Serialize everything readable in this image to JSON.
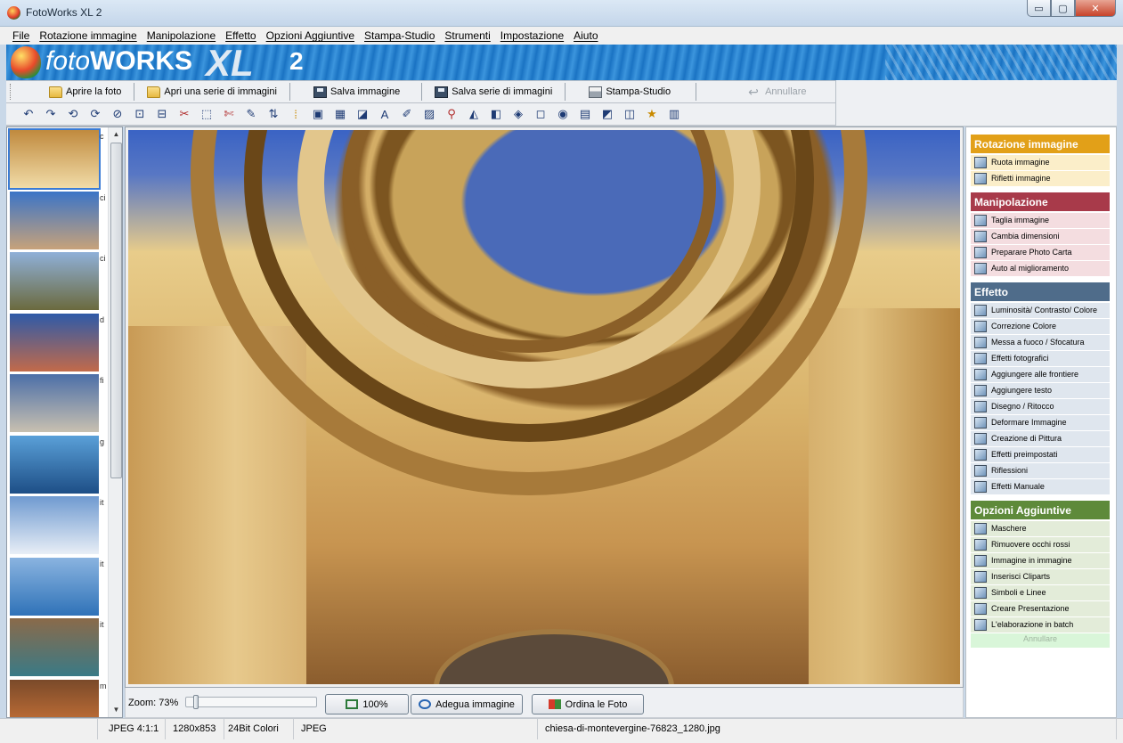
{
  "window": {
    "title": "FotoWorks XL 2",
    "minimize": "▭",
    "maximize": "▢",
    "close": "✕"
  },
  "menu": [
    "File",
    "Rotazione immagine",
    "Manipolazione",
    "Effetto",
    "Opzioni Aggiuntive",
    "Stampa-Studio",
    "Strumenti",
    "Impostazione",
    "Aiuto"
  ],
  "banner": {
    "logo_foto": "foto",
    "logo_works": "WORKS",
    "logo_xl": "XL",
    "logo_version": "2"
  },
  "toolbar": {
    "open": "Aprire la foto",
    "open_series": "Apri una serie di immagini",
    "save": "Salva immagine",
    "save_series": "Salva serie di immagini",
    "print": "Stampa-Studio",
    "undo": "Annullare"
  },
  "tools": [
    "↶",
    "↷",
    "⟲",
    "⟳",
    "⊘",
    "⊡",
    "⊟",
    "✂",
    "⬚",
    "✄",
    "✎",
    "⇅",
    "⁞",
    "▣",
    "▦",
    "◪",
    "A",
    "✐",
    "▨",
    "⚲",
    "◭",
    "◧",
    "◈",
    "◻",
    "◉",
    "▤",
    "◩",
    "◫",
    "★",
    "▥"
  ],
  "thumbnails": [
    {
      "label": "c",
      "colors": [
        "#c08a3e",
        "#f1dca8"
      ]
    },
    {
      "label": "ci",
      "colors": [
        "#3b74c7",
        "#c7a27a"
      ]
    },
    {
      "label": "ci",
      "colors": [
        "#8fb0d8",
        "#6b6a3e"
      ]
    },
    {
      "label": "d",
      "colors": [
        "#2e5aa8",
        "#c26a4a"
      ]
    },
    {
      "label": "fi",
      "colors": [
        "#4c6fa8",
        "#c8c0b0"
      ]
    },
    {
      "label": "g",
      "colors": [
        "#5aa0d8",
        "#1d4e86"
      ]
    },
    {
      "label": "it",
      "colors": [
        "#6f9ad0",
        "#e8eef6"
      ]
    },
    {
      "label": "it",
      "colors": [
        "#8ab4e0",
        "#2f72b8"
      ]
    },
    {
      "label": "it",
      "colors": [
        "#8a6a4a",
        "#3a7a86"
      ]
    },
    {
      "label": "m",
      "colors": [
        "#7a4a2a",
        "#d87a3a"
      ]
    }
  ],
  "zoom": {
    "label": "Zoom: 73%",
    "value": 73
  },
  "buttons": {
    "fit100": "100%",
    "fit": "Adegua immagine",
    "sort": "Ordina le Foto"
  },
  "sections": [
    {
      "title": "Rotazione immagine",
      "color": "#e2a018",
      "item_bg": "#fbeec9",
      "items": [
        "Ruota immagine",
        "Rifletti immagine"
      ]
    },
    {
      "title": "Manipolazione",
      "color": "#a83a4a",
      "item_bg": "#f4dde0",
      "items": [
        "Taglia immagine",
        "Cambia dimensioni",
        "Preparare Photo Carta",
        "Auto al miglioramento"
      ]
    },
    {
      "title": "Effetto",
      "color": "#4f6c8a",
      "item_bg": "#dfe6ee",
      "items": [
        "Luminosità/ Contrasto/ Colore",
        "Correzione Colore",
        "Messa a fuoco / Sfocatura",
        "Effetti fotografici",
        "Aggiungere alle frontiere",
        "Aggiungere testo",
        "Disegno / Ritocco",
        "Deformare Immagine",
        "Creazione di Pittura",
        "Effetti preimpostati",
        "Riflessioni",
        "Effetti Manuale"
      ]
    },
    {
      "title": "Opzioni Aggiuntive",
      "color": "#5e8a3a",
      "item_bg": "#e3ecd9",
      "items": [
        "Maschere",
        "Rimuovere occhi rossi",
        "Immagine in immagine",
        "Inserisci Cliparts",
        "Simboli e Linee",
        "Creare Presentazione",
        "L'elaborazione in batch"
      ]
    }
  ],
  "panel_undo": "Annullare",
  "status": {
    "format": "JPEG  4:1:1",
    "size": "1280x853",
    "depth": "24Bit Colori",
    "type": "JPEG",
    "filename": "chiesa-di-montevergine-76823_1280.jpg"
  }
}
